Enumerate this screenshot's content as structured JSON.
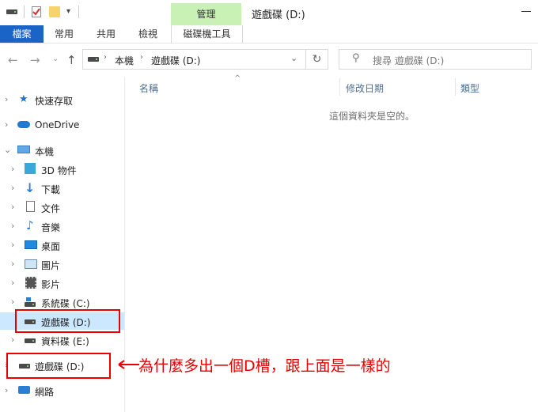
{
  "title_bar": {
    "manage_tab": "管理",
    "window_title": "遊戲碟 (D:)"
  },
  "ribbon": {
    "tabs": [
      "檔案",
      "常用",
      "共用",
      "檢視",
      "磁碟機工具"
    ]
  },
  "address": {
    "path_segments": [
      "本機",
      "遊戲碟 (D:)"
    ],
    "search_placeholder": "搜尋 遊戲碟 (D:)"
  },
  "nav_pane": {
    "quick_access": "快速存取",
    "onedrive": "OneDrive",
    "this_pc": "本機",
    "items": [
      "3D 物件",
      "下載",
      "文件",
      "音樂",
      "桌面",
      "圖片",
      "影片",
      "系統碟 (C:)",
      "遊戲碟 (D:)",
      "資料碟 (E:)"
    ],
    "extra_drive": "遊戲碟 (D:)",
    "network": "網路"
  },
  "content": {
    "columns": [
      "名稱",
      "修改日期",
      "類型"
    ],
    "empty_message": "這個資料夾是空的。"
  },
  "annotation": {
    "text": "為什麼多出一個D槽，跟上面是一樣的",
    "color": "#e60000"
  },
  "colors": {
    "file_tab": "#1a64c8",
    "manage_tab": "#c9f0b5",
    "selected": "#cce8ff"
  }
}
